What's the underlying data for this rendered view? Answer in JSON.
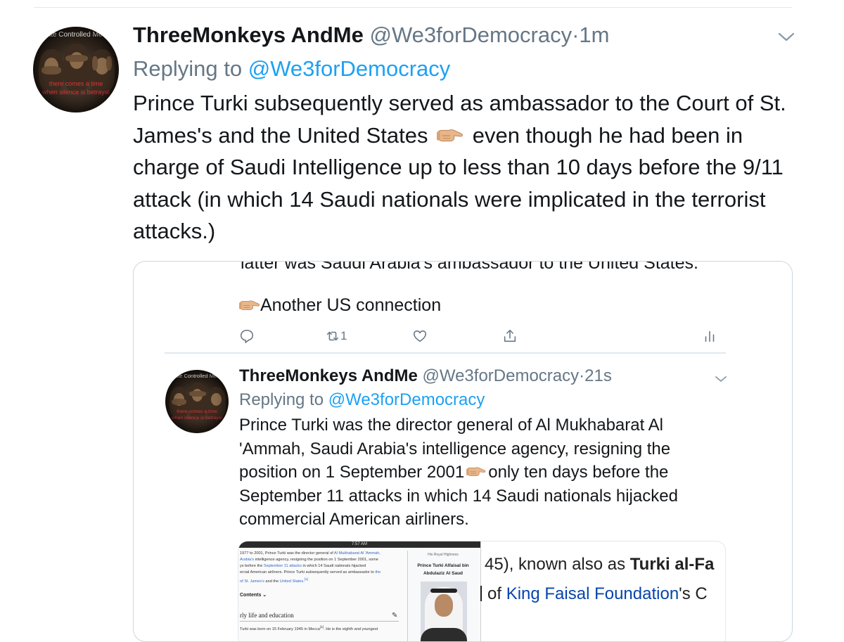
{
  "main_tweet": {
    "name": "ThreeMonkeys AndMe",
    "handle": "@We3forDemocracy",
    "separator": "·",
    "time": "1m",
    "replying_prefix": "Replying to",
    "replying_handle": "@We3forDemocracy",
    "text_part1": "Prince Turki subsequently served as ambassador to the Court of St. James's and the United States",
    "text_part2": "even though he had been in charge of Saudi Intelligence up to less than 10 days before the 9/11 attack (in which 14 Saudi nationals were implicated in the terrorist attacks.)",
    "avatar_banner": "State Controlled Media",
    "avatar_red_text1": "there comes a time",
    "avatar_red_text2": "when silence is betrayal"
  },
  "quoted": {
    "cut_text": "latter was Saudi Arabia's ambassador to the United States.",
    "another_text": "Another US connection",
    "actions": {
      "reply_icon": "comment-icon",
      "retweet_icon": "retweet-icon",
      "retweet_count": "1",
      "like_icon": "heart-icon",
      "share_icon": "share-icon",
      "analytics_icon": "analytics-icon"
    },
    "inner_tweet": {
      "name": "ThreeMonkeys AndMe",
      "handle": "@We3forDemocracy",
      "separator": "·",
      "time": "21s",
      "replying_prefix": "Replying to",
      "replying_handle": "@We3forDemocracy",
      "text_part1": "Prince Turki was the director general of Al Mukhabarat Al 'Ammah, Saudi Arabia's intelligence agency, resigning the position on 1 September 2001",
      "text_part2": "only ten days before the September 11 attacks in which 14 Saudi nationals hijacked commercial American airliners."
    },
    "media": {
      "status_time": "7:57 AM",
      "wiki_line1": "1977 to 2001, Prince Turki was the director general of",
      "wiki_link1": "Al Mukhabarat Al 'Ammah,",
      "wiki_line2a": "Arabia's",
      "wiki_line2b": "intelligence agency, resigning the position on 1 September 2001, some",
      "wiki_line3a": "ys before the",
      "wiki_link3": "September 11 attacks",
      "wiki_line3b": "in which 14 Saudi nationals hijacked",
      "wiki_line4a": "ercial American airliners. Prince Turki subsequently served as ambassador to",
      "wiki_link4": "the",
      "wiki_line5a": "of St. James's",
      "wiki_line5b": "and the",
      "wiki_link5": "United States.",
      "wiki_ref": "[1]",
      "contents_label": "Contents ⌄",
      "section_label": "rly life and education",
      "edit_icon": "pencil-icon",
      "foot_text_a": "Turki was born on 15 February 1945 in",
      "foot_link": "Mecca",
      "foot_text_b": ". He is the eighth and youngest",
      "infobox_hrh": "His Royal Highness",
      "infobox_name1": "Prince Turki Alfaisal bin",
      "infobox_name2": "Abdulaziz Al Saud",
      "preview_line1_a": "45), known also as ",
      "preview_line1_b": "Turki al-Fa",
      "preview_line2_a": "of ",
      "preview_line2_link": "King Faisal Foundation",
      "preview_line2_b": "'s C"
    }
  },
  "colors": {
    "text": "#14171a",
    "muted": "#657786",
    "link": "#1da1f2",
    "border": "#ccd6dd",
    "wiki_link": "#0645ad"
  }
}
